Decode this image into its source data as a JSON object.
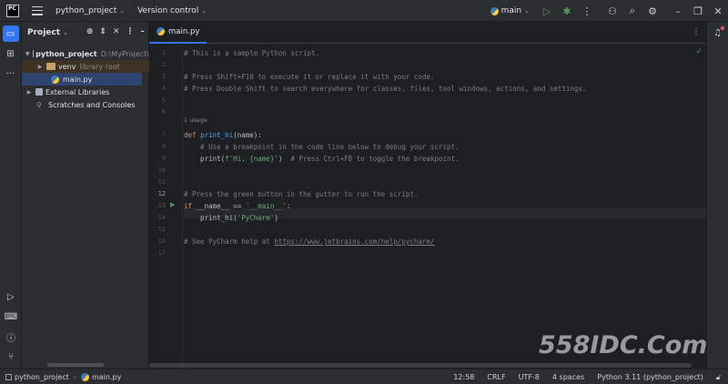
{
  "titlebar": {
    "logo": "PC",
    "project_name": "python_project",
    "vcs_label": "Version control",
    "branch": "main",
    "icons": [
      "run-icon",
      "debug-icon",
      "more-icon",
      "add-user-icon",
      "search-icon",
      "gear-icon",
      "minimize-icon",
      "restore-icon",
      "close-icon"
    ]
  },
  "project_panel": {
    "title": "Project",
    "tree": [
      {
        "label": "python_project",
        "hint": "D:\\MyProject\\"
      },
      {
        "label": "venv",
        "hint": "library root"
      },
      {
        "label": "main.py"
      },
      {
        "label": "External Libraries"
      },
      {
        "label": "Scratches and Consoles"
      }
    ]
  },
  "editor": {
    "tab": "main.py",
    "usage_hint": "1 usage",
    "line_numbers": [
      "1",
      "2",
      "3",
      "4",
      "5",
      "6",
      "7",
      "8",
      "9",
      "10",
      "11",
      "12",
      "13",
      "14",
      "15",
      "16",
      "17"
    ],
    "current_line": "12",
    "lines": {
      "l1": "# This is a sample Python script.",
      "l3": "# Press Shift+F10 to execute it or replace it with your code.",
      "l4": "# Press Double Shift to search everywhere for classes, files, tool windows, actions, and settings.",
      "l7_kw": "def ",
      "l7_fn": "print_hi",
      "l7_rest": "(name):",
      "l8": "    # Use a breakpoint in the code line below to debug your script.",
      "l9_a": "    print(",
      "l9_str": "f'Hi, {name}'",
      "l9_b": ")  ",
      "l9_cmt": "# Press Ctrl+F8 to toggle the breakpoint.",
      "l12": "# Press the green button in the gutter to run the script.",
      "l13_kw": "if ",
      "l13_a": "__name__ == ",
      "l13_str": "'__main__'",
      "l13_b": ":",
      "l14_a": "    print_hi(",
      "l14_str": "'PyCharm'",
      "l14_b": ")",
      "l16_cmt": "# See PyCharm help at ",
      "l16_link": "https://www.jetbrains.com/help/pycharm/"
    }
  },
  "statusbar": {
    "breadcrumb": [
      "python_project",
      "main.py"
    ],
    "position": "12:58",
    "line_sep": "CRLF",
    "encoding": "UTF-8",
    "indent": "4 spaces",
    "interpreter": "Python 3.11 (python_project)"
  },
  "watermark": "558IDC.Com",
  "colors": {
    "accent": "#3574f0",
    "run_green": "#57965c",
    "keyword": "#cf8e6d",
    "function": "#56a8f5",
    "string": "#6aab73",
    "comment": "#7a7e85"
  }
}
